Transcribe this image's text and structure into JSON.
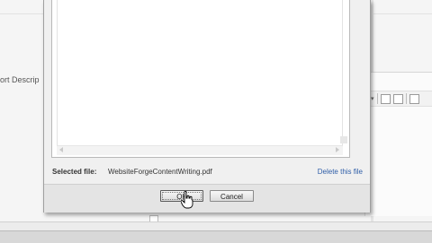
{
  "background": {
    "field_label": "ort Descrip"
  },
  "dialog": {
    "selected_label": "Selected file:",
    "selected_file": "WebsiteForgeContentWriting.pdf",
    "delete_label": "Delete this file",
    "ok_label": "OK",
    "cancel_label": "Cancel"
  },
  "icons": [
    "hand-pointer-icon",
    "scroll-left-icon",
    "scroll-right-icon",
    "toolbar-icons"
  ]
}
